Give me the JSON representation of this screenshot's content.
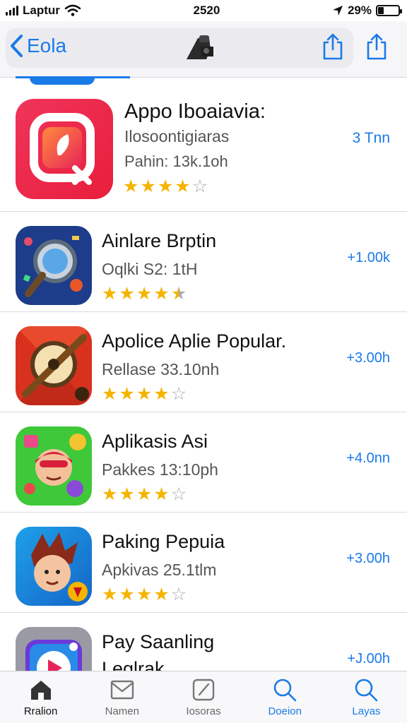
{
  "status": {
    "carrier": "Laptur",
    "time": "2520",
    "battery_text": "29%",
    "battery_fraction": 0.29
  },
  "nav": {
    "back_label": "Eola"
  },
  "apps": [
    {
      "title": "Appo Iboaiavia:",
      "subtitle": "Ilosoontigiaras",
      "subtitle2": "Pahin: 13k.1oh",
      "meta": "3 Tnn",
      "rating": 4,
      "icon": "photo-app-icon"
    },
    {
      "title": "Ainlare Brptin",
      "subtitle": "Oqlki S2: 1tH",
      "meta": "+1.00k",
      "rating": 4.5,
      "icon": "magnifier-app-icon"
    },
    {
      "title": "Apolice Aplie Popular.",
      "subtitle": "Rellase 33.10nh",
      "meta": "+3.00h",
      "rating": 4,
      "icon": "compass-app-icon"
    },
    {
      "title": "Aplikasis Asi",
      "subtitle": "Pakkes 13:10ph",
      "meta": "+4.0nn",
      "rating": 4,
      "icon": "hero-app-icon"
    },
    {
      "title": "Paking Pepuia",
      "subtitle": "Apkivas 25.1tlm",
      "meta": "+3.00h",
      "rating": 4,
      "icon": "character-app-icon"
    },
    {
      "title": "Pay Saanling",
      "title_line2": "Leglrak",
      "meta": "+J.00h",
      "icon": "video-app-icon"
    }
  ],
  "tabs": [
    {
      "label": "Rralion",
      "icon": "home-icon"
    },
    {
      "label": "Namen",
      "icon": "mail-icon"
    },
    {
      "label": "Iosoras",
      "icon": "edit-icon"
    },
    {
      "label": "Doeion",
      "icon": "search-icon"
    },
    {
      "label": "Layas",
      "icon": "search-icon"
    }
  ],
  "colors": {
    "accent": "#1a7ae8",
    "star": "#f4b400"
  }
}
